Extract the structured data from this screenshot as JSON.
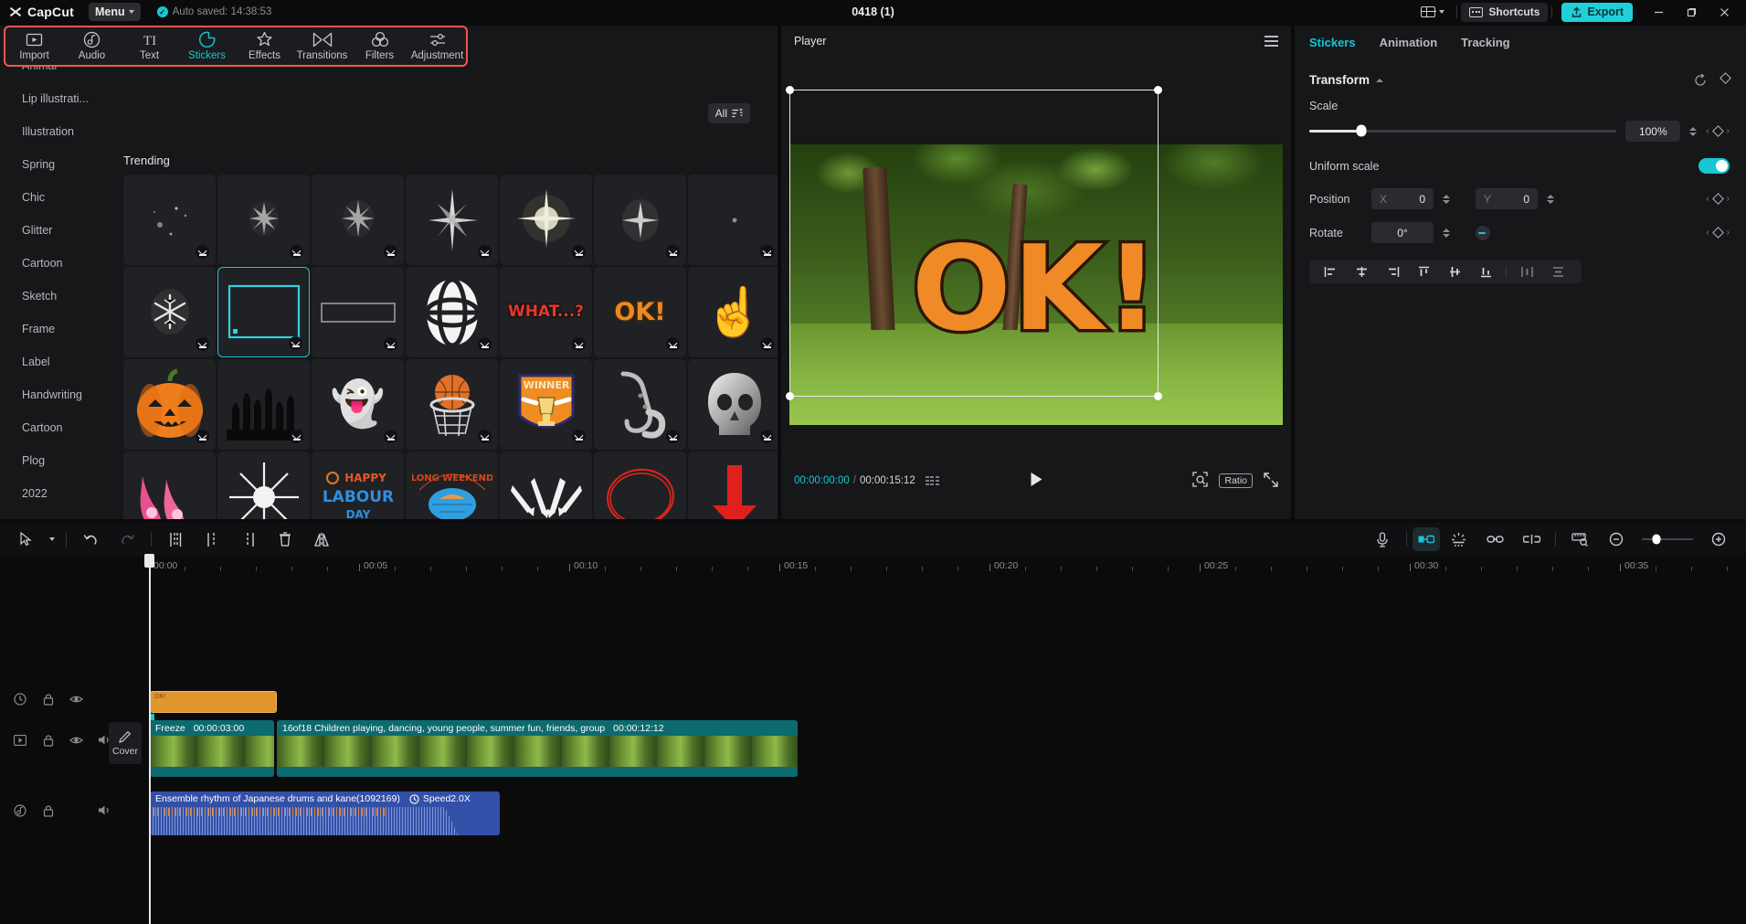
{
  "titlebar": {
    "brand": "CapCut",
    "menu_label": "Menu",
    "autosave_text": "Auto saved: 14:38:53",
    "project_title": "0418 (1)",
    "shortcuts_label": "Shortcuts",
    "export_label": "Export",
    "minimize": "—",
    "maximize": "❐",
    "close": "✕"
  },
  "tool_tabs": [
    {
      "label": "Import",
      "icon": "import-icon",
      "active": false
    },
    {
      "label": "Audio",
      "icon": "audio-icon",
      "active": false
    },
    {
      "label": "Text",
      "icon": "text-icon",
      "active": false
    },
    {
      "label": "Stickers",
      "icon": "stickers-icon",
      "active": true
    },
    {
      "label": "Effects",
      "icon": "effects-icon",
      "active": false
    },
    {
      "label": "Transitions",
      "icon": "transitions-icon",
      "active": false
    },
    {
      "label": "Filters",
      "icon": "filters-icon",
      "active": false
    },
    {
      "label": "Adjustment",
      "icon": "adjustment-icon",
      "active": false
    }
  ],
  "categories": [
    "Animal",
    "Lip illustrati...",
    "Illustration",
    "Spring",
    "Chic",
    "Glitter",
    "Cartoon",
    "Sketch",
    "Frame",
    "Label",
    "Handwriting",
    "Cartoon",
    "Plog",
    "2022"
  ],
  "browser": {
    "filter_label": "All",
    "section_title": "Trending",
    "stickers": [
      {
        "name": "sparkle-dust-1",
        "art": "·  ✦ ·",
        "kind": "sparkle",
        "selected": false
      },
      {
        "name": "sparkle-burst-2",
        "art": "✳",
        "kind": "sparkle",
        "selected": false
      },
      {
        "name": "sparkle-burst-3",
        "art": "✳",
        "kind": "sparkle",
        "selected": false
      },
      {
        "name": "four-point-star",
        "art": "✦",
        "kind": "sparkle",
        "selected": false
      },
      {
        "name": "starburst-glow",
        "art": "✵",
        "kind": "sparkle",
        "selected": false
      },
      {
        "name": "sparkle-cluster",
        "art": "✷",
        "kind": "sparkle",
        "selected": false
      },
      {
        "name": "tiny-dot-sparkle",
        "art": "·",
        "kind": "sparkle",
        "selected": false
      },
      {
        "name": "snowflake-sparkle",
        "art": "❉",
        "kind": "sparkle",
        "selected": false
      },
      {
        "name": "cyan-rect-frame",
        "art": "",
        "kind": "cyanframe",
        "selected": true
      },
      {
        "name": "grey-bar-frame",
        "art": "",
        "kind": "greyframe",
        "selected": false
      },
      {
        "name": "globe-shape",
        "art": "",
        "kind": "globe",
        "selected": false
      },
      {
        "name": "what-text",
        "art": "WHAT...?",
        "kind": "whattext",
        "selected": false
      },
      {
        "name": "ok-text",
        "art": "OK!",
        "kind": "oktext",
        "selected": false
      },
      {
        "name": "pointing-finger",
        "art": "☝",
        "kind": "emoji",
        "selected": false
      },
      {
        "name": "jack-o-lantern",
        "art": "🎃",
        "kind": "emoji",
        "selected": false
      },
      {
        "name": "zombie-hands",
        "art": "",
        "kind": "hands",
        "selected": false
      },
      {
        "name": "ghost",
        "art": "👻",
        "kind": "emoji",
        "selected": false
      },
      {
        "name": "basketball-hoop",
        "art": "🏀",
        "kind": "emoji",
        "selected": false
      },
      {
        "name": "winner-trophy-badge",
        "art": "WINNER",
        "kind": "winner",
        "selected": false
      },
      {
        "name": "saxophone",
        "art": "🎷",
        "kind": "emoji",
        "selected": false
      },
      {
        "name": "chrome-skull",
        "art": "💀",
        "kind": "emoji",
        "selected": false
      },
      {
        "name": "pink-high-heels",
        "art": "👠",
        "kind": "emoji",
        "selected": false
      },
      {
        "name": "eight-point-star",
        "art": "✴",
        "kind": "sparkle",
        "selected": false
      },
      {
        "name": "happy-labour-day",
        "art": "HAPPY\nLABOUR\nDAY",
        "kind": "labour",
        "selected": false
      },
      {
        "name": "long-weekend-badge",
        "art": "LONG WEEKEND",
        "kind": "weekend",
        "selected": false
      },
      {
        "name": "white-arrows",
        "art": "↘↓↙",
        "kind": "arrows",
        "selected": false
      },
      {
        "name": "red-circle-scribble",
        "art": "◯",
        "kind": "redcircle",
        "selected": false
      },
      {
        "name": "red-down-arrow",
        "art": "⬇",
        "kind": "redarrow",
        "selected": false
      }
    ]
  },
  "player": {
    "panel_label": "Player",
    "current_time": "00:00:00:00",
    "time_separator": "/",
    "total_time": "00:00:15:12",
    "ratio_label": "Ratio",
    "overlay_text": "OK!"
  },
  "properties": {
    "tabs": [
      {
        "label": "Stickers",
        "active": true
      },
      {
        "label": "Animation",
        "active": false
      },
      {
        "label": "Tracking",
        "active": false
      }
    ],
    "section_title": "Transform",
    "scale_label": "Scale",
    "scale_value": "100%",
    "uniform_scale_label": "Uniform scale",
    "uniform_scale_on": true,
    "position_label": "Position",
    "position_x_axis": "X",
    "position_x": "0",
    "position_y_axis": "Y",
    "position_y": "0",
    "rotate_label": "Rotate",
    "rotate_value": "0°",
    "align_icons": [
      "align-left-icon",
      "align-center-horizontal-icon",
      "align-right-icon",
      "align-top-icon",
      "align-middle-vertical-icon",
      "align-bottom-icon",
      "distribute-horizontal-icon",
      "distribute-vertical-icon"
    ]
  },
  "timeline": {
    "toolbar_left_icons": [
      "select-tool-icon",
      "undo-icon",
      "redo-icon",
      "split-icon",
      "trim-left-icon",
      "trim-right-icon",
      "delete-icon",
      "mirror-icon"
    ],
    "toolbar_right_icons": [
      "microphone-icon",
      "auto-caption-icon",
      "stabilize-icon",
      "link-icon",
      "unlink-icon",
      "ruler-zoom-icon",
      "zoom-out-icon",
      "zoom-in-icon"
    ],
    "ruler_labels": [
      "00:00",
      "00:05",
      "00:10",
      "00:15",
      "00:20",
      "00:25",
      "00:30",
      "00:35"
    ],
    "cover_label": "Cover",
    "clips": {
      "sticker": {
        "name": "sticker-clip",
        "label": "OK!"
      },
      "video_seg1": {
        "title": "Freeze",
        "duration": "00:00:03:00"
      },
      "video_seg2": {
        "title": "16of18 Children playing, dancing, young people, summer fun, friends, group",
        "duration": "00:00:12:12"
      },
      "audio": {
        "title": "Ensemble rhythm of Japanese drums and kane(1092169)",
        "speed": "Speed2.0X"
      }
    }
  },
  "colors": {
    "accent": "#17c7d4",
    "highlight_border": "#f4544f",
    "sticker_clip": "#e2942d",
    "video_clip": "#0d6a6e",
    "audio_clip": "#3350a8"
  }
}
